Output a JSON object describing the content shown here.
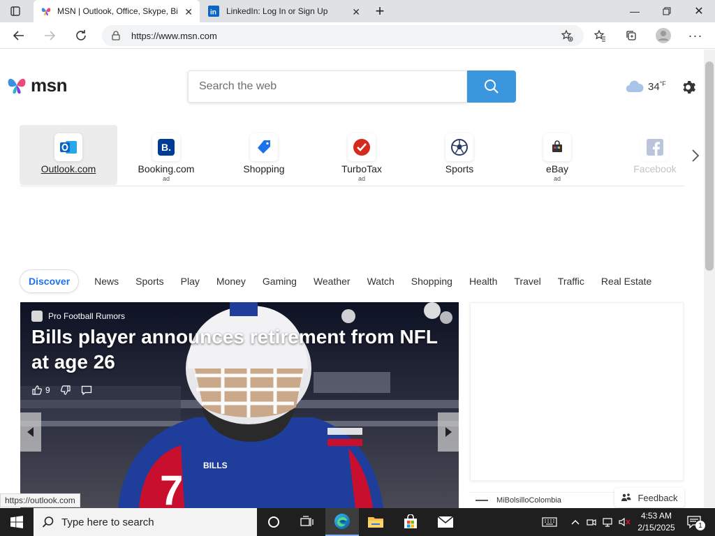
{
  "browser": {
    "tabs": [
      {
        "title": "MSN | Outlook, Office, Skype, Bi",
        "active": true
      },
      {
        "title": "LinkedIn: Log In or Sign Up",
        "active": false
      }
    ],
    "url": "https://www.msn.com"
  },
  "header": {
    "logo_text": "msn",
    "search_placeholder": "Search the web",
    "weather_temp": "34",
    "weather_unit": "°F"
  },
  "tiles": [
    {
      "label": "Outlook.com",
      "ad": "",
      "icon": "outlook-icon",
      "color": "#0a64c2"
    },
    {
      "label": "Booking.com",
      "ad": "ad",
      "icon": "booking-icon",
      "color": "#003b95"
    },
    {
      "label": "Shopping",
      "ad": "",
      "icon": "shopping-tag-icon",
      "color": "#1a73e8"
    },
    {
      "label": "TurboTax",
      "ad": "ad",
      "icon": "turbotax-icon",
      "color": "#d52b1e"
    },
    {
      "label": "Sports",
      "ad": "",
      "icon": "sports-ball-icon",
      "color": "#2b3a67"
    },
    {
      "label": "eBay",
      "ad": "ad",
      "icon": "ebay-icon",
      "color": "#333333"
    },
    {
      "label": "Facebook",
      "ad": "",
      "icon": "facebook-icon",
      "color": "#3b5998"
    }
  ],
  "categories": [
    "Discover",
    "News",
    "Sports",
    "Play",
    "Money",
    "Gaming",
    "Weather",
    "Watch",
    "Shopping",
    "Health",
    "Travel",
    "Traffic",
    "Real Estate"
  ],
  "hero": {
    "source": "Pro Football Rumors",
    "headline": "Bills player announces retirement from NFL at age 26",
    "likes": "9"
  },
  "side": {
    "source": "MiBolsilloColombia"
  },
  "feedback_label": "Feedback",
  "status_url": "https://outlook.com",
  "taskbar": {
    "search_placeholder": "Type here to search",
    "time": "4:53 AM",
    "date": "2/15/2025",
    "notification_count": "1"
  }
}
